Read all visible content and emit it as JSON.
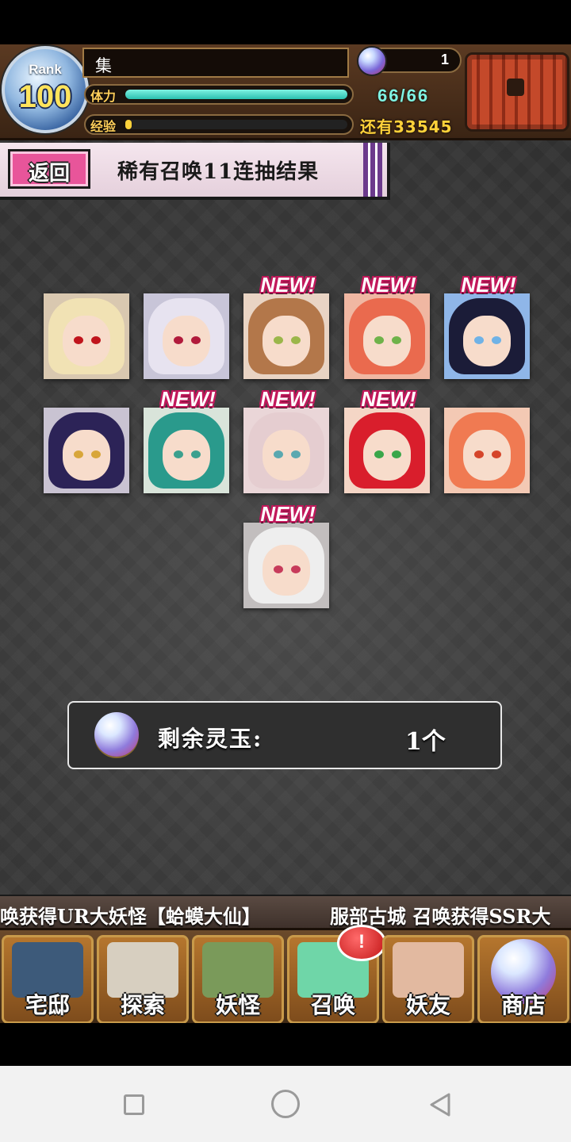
{
  "hud": {
    "rank_label": "Rank",
    "rank_value": "100",
    "player_name": "集",
    "stamina_label": "体力",
    "stamina_value": "66/66",
    "stamina_fraction": 1.0,
    "exp_label": "经验",
    "exp_fraction": 0.02,
    "exp_remaining": "还有33545",
    "orb_count": "1"
  },
  "banner": {
    "back_label": "返回",
    "title": "稀有召唤11连抽结果"
  },
  "cards": [
    {
      "is_new": false,
      "hair": "#f1e2b4",
      "eye": "#c0141c",
      "bg": "#d9c8b0"
    },
    {
      "is_new": false,
      "hair": "#e7e3f0",
      "eye": "#b11b3c",
      "bg": "#c8c5d8"
    },
    {
      "is_new": true,
      "hair": "#b3774a",
      "eye": "#9bb64a",
      "bg": "#e9d4c4"
    },
    {
      "is_new": true,
      "hair": "#ea6a4e",
      "eye": "#6fb24a",
      "bg": "#f0b7a2"
    },
    {
      "is_new": true,
      "hair": "#1b1c38",
      "eye": "#6fb2e6",
      "bg": "#8fb6e8"
    },
    {
      "is_new": false,
      "hair": "#2c2357",
      "eye": "#d8a63a",
      "bg": "#c9c3d2"
    },
    {
      "is_new": true,
      "hair": "#2a9a8c",
      "eye": "#3ca08e",
      "bg": "#d9e4da"
    },
    {
      "is_new": true,
      "hair": "#e5cdd0",
      "eye": "#5aa8b0",
      "bg": "#ead6d8"
    },
    {
      "is_new": true,
      "hair": "#d91e2c",
      "eye": "#3aa64a",
      "bg": "#f4d6c6"
    },
    {
      "is_new": false,
      "hair": "#f07a52",
      "eye": "#d5452a",
      "bg": "#f3c9b4"
    },
    {
      "is_new": true,
      "hair": "#eeeeee",
      "eye": "#c73b5b",
      "bg": "#c2bebe"
    }
  ],
  "new_label": "NEW!",
  "remaining": {
    "label": "剩余灵玉:",
    "value": "1个"
  },
  "ticker": {
    "left_text": "唤获得UR大妖怪【蛤蟆大仙】",
    "right_text": "服部古城 召唤获得SSR大"
  },
  "nav": [
    {
      "label": "宅邸",
      "art": "#3d5a7a",
      "icon": "mansion-icon"
    },
    {
      "label": "探索",
      "art": "#d7cfc0",
      "icon": "magnifier-icon"
    },
    {
      "label": "妖怪",
      "art": "#7a9a5a",
      "icon": "scroll-icon"
    },
    {
      "label": "召唤",
      "art": "#6fd6a8",
      "icon": "pentagram-icon",
      "badge": "!"
    },
    {
      "label": "妖友",
      "art": "#e2b9a0",
      "icon": "friend-icon"
    },
    {
      "label": "商店",
      "art": "#b6b8f0",
      "icon": "orb-shop-icon"
    }
  ],
  "colors": {
    "new_outline": "#c2185b",
    "stamina_fill": "#2ac0b0",
    "exp_fill": "#ffd23a",
    "back_button": "#e8559a"
  }
}
